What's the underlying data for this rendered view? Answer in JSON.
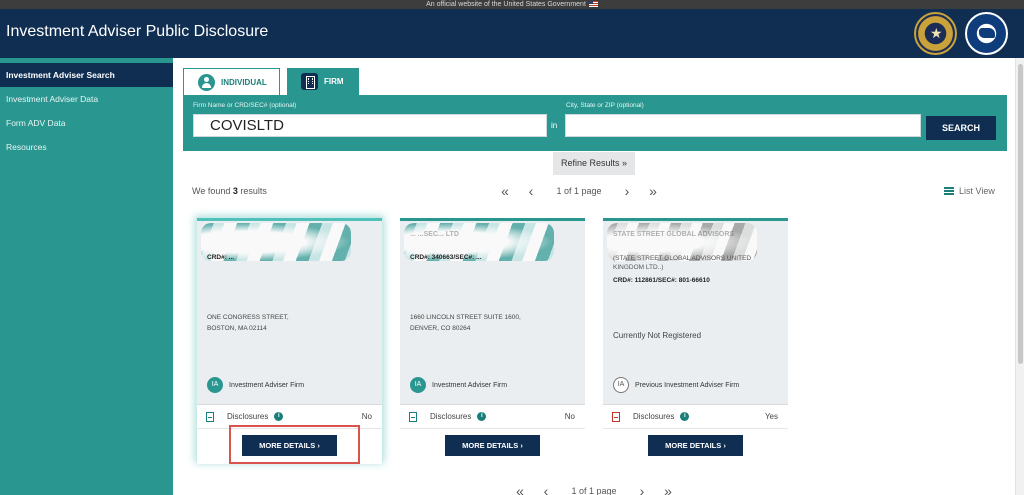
{
  "gov_banner": "An official website of the United States Government",
  "header": {
    "title": "Investment Adviser Public Disclosure"
  },
  "sidebar": {
    "items": [
      {
        "label": "Investment Adviser Search"
      },
      {
        "label": "Investment Adviser Data"
      },
      {
        "label": "Form ADV Data"
      },
      {
        "label": "Resources"
      }
    ]
  },
  "tabs": {
    "individual": "INDIVIDUAL",
    "firm": "FIRM"
  },
  "search": {
    "firm_label": "Firm Name or CRD/SEC# (optional)",
    "firm_value": "COVISLTD",
    "in_label": "in",
    "location_label": "City, State or ZIP (optional)",
    "location_value": "",
    "button": "SEARCH"
  },
  "refine": {
    "label": "Refine Results",
    "icon": "double-chevron-down"
  },
  "results": {
    "prefix": "We found",
    "count": "3",
    "suffix": "results",
    "page_text": "1 of 1 page",
    "list_view": "List View"
  },
  "cards": [
    {
      "name": "",
      "crd": "CRD#: ...",
      "alt_name": "",
      "address1": "ONE CONGRESS STREET,",
      "address2": "BOSTON, MA 02114",
      "status": "",
      "type": "Investment Adviser Firm",
      "badge": "IA",
      "disclosures_label": "Disclosures",
      "disclosures_value": "No",
      "button": "MORE DETAILS ›"
    },
    {
      "name": "... ...SEC... LTD",
      "crd": "CRD#: 340663/SEC#: ...",
      "alt_name": "",
      "address1": "1660 LINCOLN STREET SUITE 1600,",
      "address2": "DENVER, CO 80264",
      "status": "",
      "type": "Investment Adviser Firm",
      "badge": "IA",
      "disclosures_label": "Disclosures",
      "disclosures_value": "No",
      "button": "MORE DETAILS ›"
    },
    {
      "name": "STATE STREET GLOBAL ADVISORS",
      "crd": "CRD#: 112861/SEC#: 801-66610",
      "alt_name": "(STATE STREET GLOBAL ADVISORS UNITED KINGDOM LTD..)",
      "address1": "",
      "address2": "",
      "status": "Currently Not Registered",
      "type": "Previous Investment Adviser Firm",
      "badge": "IA",
      "disclosures_label": "Disclosures",
      "disclosures_value": "Yes",
      "button": "MORE DETAILS ›"
    }
  ],
  "icons": {
    "pager_first": "«",
    "pager_prev": "‹",
    "pager_next": "›",
    "pager_last": "»",
    "info": "i"
  },
  "colors": {
    "navy": "#0f2e52",
    "teal": "#2a9690",
    "highlight": "#d9534f"
  }
}
